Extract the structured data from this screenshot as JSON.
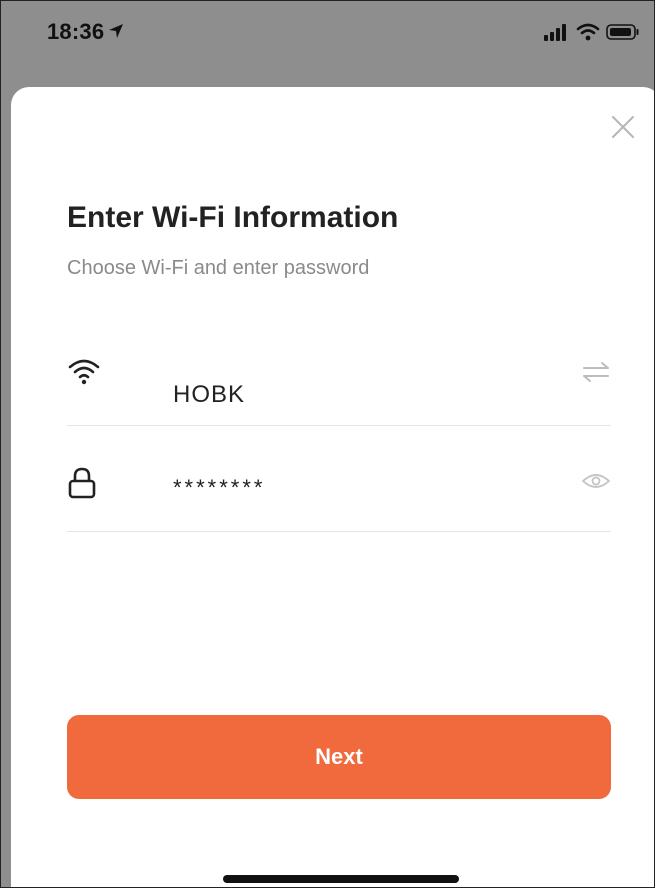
{
  "status_bar": {
    "time": "18:36",
    "location_icon": "location-arrow-icon",
    "icons": [
      "signal-icon",
      "wifi-icon",
      "battery-icon"
    ]
  },
  "dialog": {
    "close_icon": "close-icon",
    "title": "Enter Wi-Fi Information",
    "subtitle": "Choose Wi-Fi and enter password",
    "wifi_row": {
      "icon": "wifi-icon",
      "value": "HOBK",
      "action_icon": "switch-network-icon"
    },
    "password_row": {
      "icon": "lock-icon",
      "value": "********",
      "action_icon": "eye-icon"
    },
    "next_label": "Next"
  },
  "colors": {
    "accent": "#f06a3e",
    "title": "#222222",
    "subtitle": "#8a8a8a",
    "divider": "#e6e6e6",
    "backdrop": "#8e8e8e"
  }
}
